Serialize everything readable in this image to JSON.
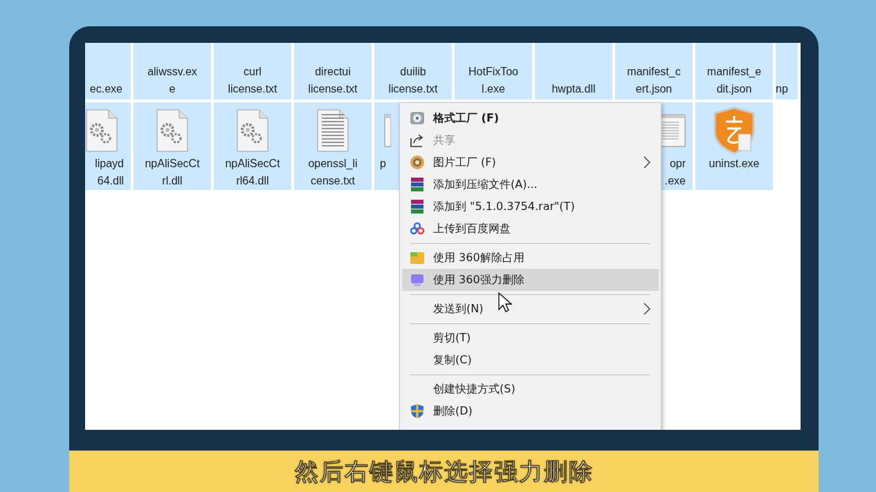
{
  "files": {
    "row_1": [
      {
        "label": "ec.exe"
      },
      {
        "label": "aliwssv.ex\ne"
      },
      {
        "label": "curl\nlicense.txt"
      },
      {
        "label": "directui\nlicense.txt"
      },
      {
        "label": "duilib\nlicense.txt"
      },
      {
        "label": "HotFixToo\nl.exe"
      },
      {
        "label": "hwpta.dll"
      },
      {
        "label": "manifest_c\nert.json"
      },
      {
        "label": "manifest_e\ndit.json"
      },
      {
        "label": "np"
      }
    ],
    "row_2": [
      {
        "kind": "dll",
        "label": "lipayd\n64.dll"
      },
      {
        "kind": "dll",
        "label": "npAliSecCt\nrl.dll"
      },
      {
        "kind": "dll",
        "label": "npAliSecCt\nrl64.dll"
      },
      {
        "kind": "txt",
        "label": "openssl_li\ncense.txt"
      },
      {
        "kind": "app-edge",
        "label": "p"
      },
      {
        "kind": "app",
        "label": "opr\n.exe"
      },
      {
        "kind": "shield",
        "label": "uninst.exe"
      }
    ]
  },
  "context_menu": [
    {
      "kind": "format-app",
      "label": "格式工厂 (F)",
      "bold": true,
      "disabled": false,
      "submenu": false,
      "selected": false
    },
    {
      "kind": "share",
      "label": "共享",
      "bold": false,
      "disabled": true,
      "submenu": false,
      "selected": false
    },
    {
      "kind": "picture-app",
      "label": "图片工厂 (F)",
      "bold": false,
      "disabled": false,
      "submenu": true,
      "selected": false
    },
    {
      "kind": "archive",
      "label": "添加到压缩文件(A)...",
      "bold": false,
      "disabled": false,
      "submenu": false,
      "selected": false
    },
    {
      "kind": "archive",
      "label": "添加到 \"5.1.0.3754.rar\"(T)",
      "bold": false,
      "disabled": false,
      "submenu": false,
      "selected": false
    },
    {
      "kind": "cloud",
      "label": "上传到百度网盘",
      "bold": false,
      "disabled": false,
      "submenu": false,
      "selected": false
    },
    {
      "kind": "separator"
    },
    {
      "kind": "unlock",
      "label": "使用 360解除占用",
      "bold": false,
      "disabled": false,
      "submenu": false,
      "selected": false
    },
    {
      "kind": "shred",
      "label": "使用 360强力删除",
      "bold": false,
      "disabled": false,
      "submenu": false,
      "selected": true
    },
    {
      "kind": "separator"
    },
    {
      "kind": "plain",
      "label": "发送到(N)",
      "bold": false,
      "disabled": false,
      "submenu": true,
      "selected": false
    },
    {
      "kind": "separator"
    },
    {
      "kind": "plain",
      "label": "剪切(T)",
      "bold": false,
      "disabled": false,
      "submenu": false,
      "selected": false
    },
    {
      "kind": "plain",
      "label": "复制(C)",
      "bold": false,
      "disabled": false,
      "submenu": false,
      "selected": false
    },
    {
      "kind": "separator"
    },
    {
      "kind": "plain",
      "label": "创建快捷方式(S)",
      "bold": false,
      "disabled": false,
      "submenu": false,
      "selected": false
    },
    {
      "kind": "shield",
      "label": "删除(D)",
      "bold": false,
      "disabled": false,
      "submenu": false,
      "selected": false
    }
  ],
  "subtitle": "然后右键鼠标选择强力删除"
}
